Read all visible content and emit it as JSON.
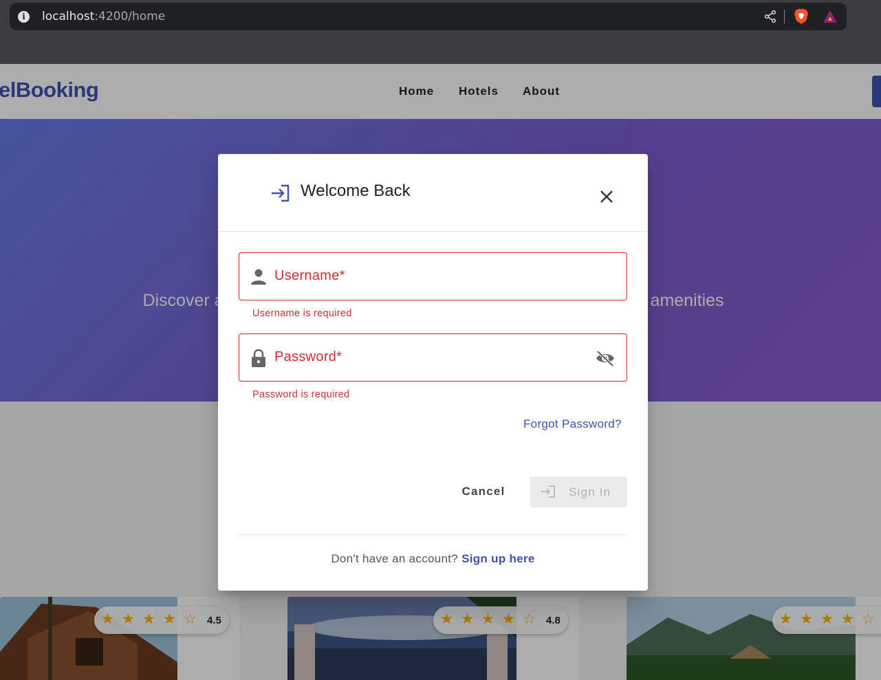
{
  "browser": {
    "url_host": "localhost",
    "url_path": ":4200/home"
  },
  "navbar": {
    "brand": "elBooking",
    "links": [
      "Home",
      "Hotels",
      "About"
    ]
  },
  "hero": {
    "subtitle_left": "Discover a",
    "subtitle_right": "amenities"
  },
  "hotel_cards": [
    {
      "rating": "4.5",
      "stars": 4.5
    },
    {
      "rating": "4.8",
      "stars": 4.5
    },
    {
      "rating": "",
      "stars": 4.5
    }
  ],
  "dialog": {
    "title": "Welcome Back",
    "username": {
      "label": "Username*",
      "value": "",
      "error": "Username is required"
    },
    "password": {
      "label": "Password*",
      "value": "",
      "error": "Password is required"
    },
    "forgot_label": "Forgot Password?",
    "cancel_label": "Cancel",
    "signin_label": "Sign In",
    "footer_prompt": "Don't have an account?",
    "signup_label": "Sign up here"
  },
  "colors": {
    "primary": "#3f51b5",
    "error": "#d32f2f",
    "star": "#f5b400"
  }
}
